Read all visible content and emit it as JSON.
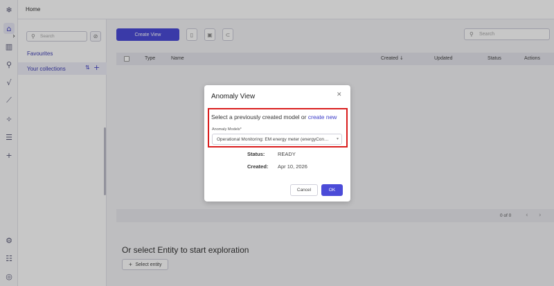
{
  "app": {
    "logo_icon": "snowflake-logo-icon"
  },
  "rail": {
    "items": [
      {
        "icon": "home-icon"
      },
      {
        "icon": "bar-chart-icon"
      },
      {
        "icon": "search-icon"
      },
      {
        "icon": "sqrt-function-icon"
      },
      {
        "icon": "trend-line-icon"
      },
      {
        "icon": "sparkle-icon"
      },
      {
        "icon": "list-icon"
      },
      {
        "icon": "plus-icon"
      }
    ],
    "bottom_items": [
      {
        "icon": "settings-gear-icon"
      },
      {
        "icon": "sliders-icon"
      },
      {
        "icon": "user-account-icon"
      }
    ]
  },
  "topbar": {
    "breadcrumb": "Home"
  },
  "collections": {
    "search_placeholder": "Search",
    "favourites_label": "Favourites",
    "your_collections_label": "Your collections"
  },
  "main": {
    "create_view_label": "Create View",
    "search_placeholder": "Search",
    "table_headers": {
      "type": "Type",
      "name": "Name",
      "created": "Created",
      "updated": "Updated",
      "status": "Status",
      "actions": "Actions"
    },
    "sort_indicator": "↓",
    "pagination": "0 of 0",
    "explore_heading": "Or select Entity to start exploration",
    "select_entity_label": "Select entity"
  },
  "modal": {
    "title": "Anomaly View",
    "prompt_text": "Select a previously created model or ",
    "prompt_link": "create new",
    "field_label": "Anomaly Models*",
    "selected_model": "Operational Monitoring: EM energy meter (energyCon…",
    "status_label": "Status:",
    "status_value": "READY",
    "created_label": "Created:",
    "created_value": "Apr 10, 2026",
    "cancel_label": "Cancel",
    "ok_label": "OK"
  },
  "colors": {
    "accent": "#4b4bd8",
    "highlight_border": "#d91c1c",
    "link": "#3a3ac8"
  }
}
